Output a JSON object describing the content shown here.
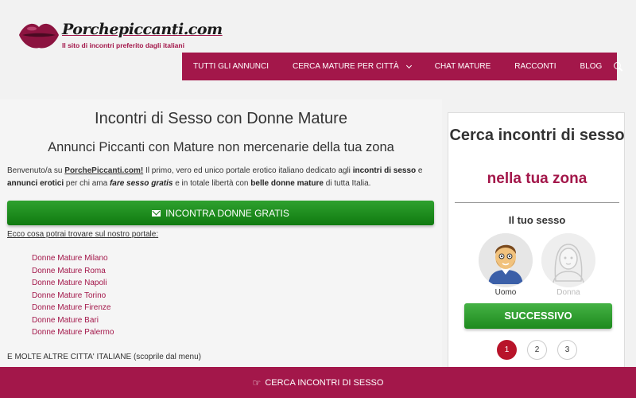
{
  "brand": {
    "logo_text": "Porchepiccanti.com",
    "tagline": "Il sito di incontri preferito dagli italiani",
    "accent_color": "#a3174a",
    "green_color": "#1e8a1e"
  },
  "nav": {
    "items": [
      {
        "label": "TUTTI GLI ANNUNCI"
      },
      {
        "label": "CERCA MATURE PER CITTÀ",
        "has_dropdown": true
      },
      {
        "label": "CHAT MATURE"
      },
      {
        "label": "RACCONTI"
      },
      {
        "label": "BLOG"
      }
    ],
    "search_icon": "search-icon"
  },
  "main": {
    "title": "Incontri di Sesso con Donne Mature",
    "subtitle": "Annunci Piccanti con Mature non mercenarie della tua zona",
    "intro": {
      "t1": "Benvenuto/a su ",
      "site": "PorchePiccanti.com!",
      "t2": " Il primo, vero ed unico portale erotico italiano dedicato agli ",
      "b1": "incontri di sesso",
      "t3": " e ",
      "b2": "annunci erotici",
      "t4": " per chi ama ",
      "b3": "fare sesso gratis",
      "t5": " e in totale libertà con ",
      "b4": "belle donne mature",
      "t6": " di tutta Italia."
    },
    "cta_label": "INCONTRA DONNE GRATIS",
    "cta_icon": "envelope-icon",
    "portal_note": "Ecco cosa potrai trovare sul nostro portale:",
    "cities": [
      "Donne Mature Milano",
      "Donne Mature Roma",
      "Donne Mature Napoli",
      "Donne Mature Torino",
      "Donne Mature Firenze",
      "Donne Mature Bari",
      "Donne Mature Palermo"
    ],
    "more_cities": "E MOLTE ALTRE CITTA' ITALIANE (scoprile dal menu)"
  },
  "sidebar": {
    "title_line1": "Cerca incontri di sesso",
    "title_line2": "nella tua zona",
    "sex_label": "Il tuo sesso",
    "option_man": "Uomo",
    "option_woman": "Donna",
    "selected": "Uomo",
    "next_label": "SUCCESSIVO",
    "steps": [
      "1",
      "2",
      "3"
    ],
    "active_step": 1
  },
  "bottom_bar": {
    "label": "CERCA INCONTRI DI SESSO",
    "icon": "hand-pointer-icon"
  }
}
